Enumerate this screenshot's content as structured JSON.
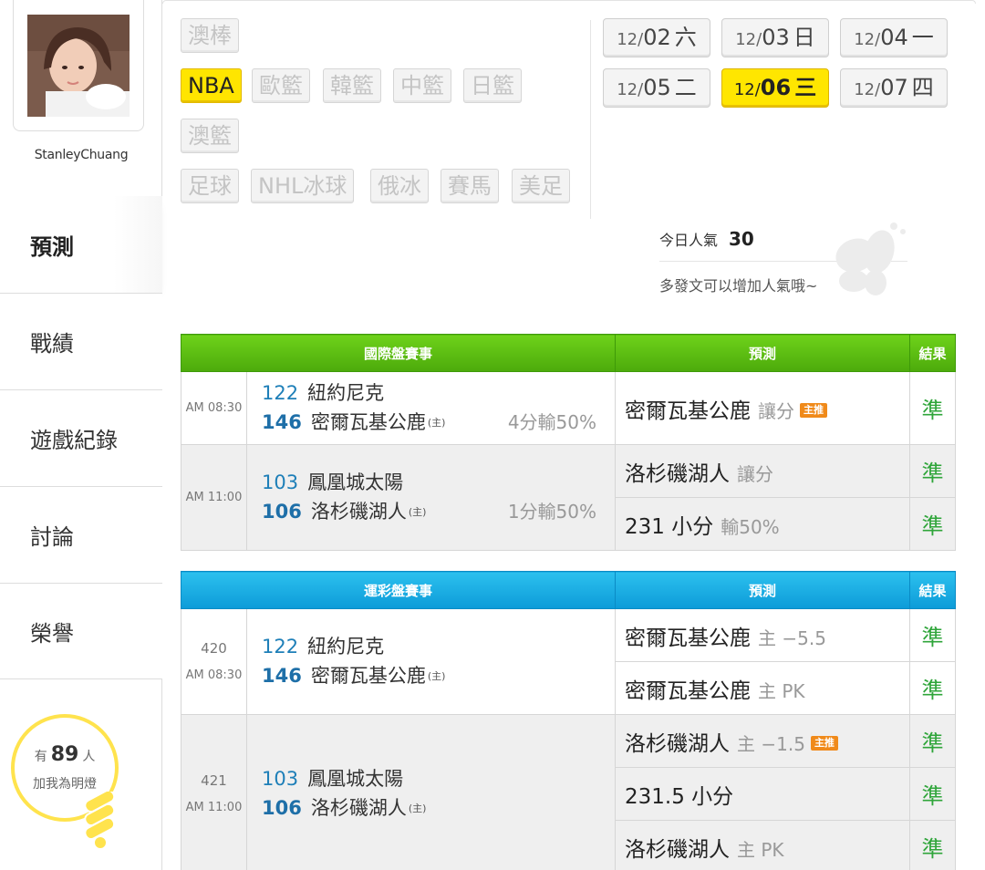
{
  "user": {
    "name": "StanleyChuang"
  },
  "nav": [
    {
      "label": "預測"
    },
    {
      "label": "戰績"
    },
    {
      "label": "遊戲紀錄"
    },
    {
      "label": "討論"
    },
    {
      "label": "榮譽"
    }
  ],
  "fans": {
    "prefix": "有",
    "count": "89",
    "suffix": "人",
    "line2": "加我為明燈"
  },
  "sports": [
    "澳棒",
    "NBA",
    "歐籃",
    "韓籃",
    "中籃",
    "日籃",
    "澳籃",
    "足球",
    "NHL冰球",
    "俄冰",
    "賽馬",
    "美足"
  ],
  "active_sport": "NBA",
  "dates": [
    {
      "md": "12/",
      "day": "02",
      "wk": "六"
    },
    {
      "md": "12/",
      "day": "03",
      "wk": "日"
    },
    {
      "md": "12/",
      "day": "04",
      "wk": "一"
    },
    {
      "md": "12/",
      "day": "05",
      "wk": "二"
    },
    {
      "md": "12/",
      "day": "06",
      "wk": "三"
    },
    {
      "md": "12/",
      "day": "07",
      "wk": "四"
    }
  ],
  "active_date": "12/06",
  "popularity": {
    "label": "今日人氣",
    "value": "30",
    "tip": "多發文可以增加人氣哦~"
  },
  "intl": {
    "headers": {
      "match": "國際盤賽事",
      "pred": "預測",
      "result": "結果"
    },
    "games": [
      {
        "time": "AM 08:30",
        "away_no": "122",
        "away": "紐約尼克",
        "home_no": "146",
        "home": "密爾瓦基公鹿",
        "host": "(主)",
        "spread": "4分輸50%",
        "preds": [
          {
            "main": "密爾瓦基公鹿",
            "sub": "讓分",
            "badge": "主推",
            "result": "準"
          }
        ]
      },
      {
        "time": "AM 11:00",
        "away_no": "103",
        "away": "鳳凰城太陽",
        "home_no": "106",
        "home": "洛杉磯湖人",
        "host": "(主)",
        "spread": "1分輸50%",
        "preds": [
          {
            "main": "洛杉磯湖人",
            "sub": "讓分",
            "result": "準"
          },
          {
            "main": "231 小分",
            "sub": "輸50%",
            "result": "準"
          }
        ]
      }
    ]
  },
  "sportslottery": {
    "headers": {
      "match": "運彩盤賽事",
      "pred": "預測",
      "result": "結果"
    },
    "games": [
      {
        "no": "420",
        "time": "AM 08:30",
        "away_no": "122",
        "away": "紐約尼克",
        "home_no": "146",
        "home": "密爾瓦基公鹿",
        "host": "(主)",
        "preds": [
          {
            "main": "密爾瓦基公鹿",
            "sub": "主 −5.5",
            "result": "準"
          },
          {
            "main": "密爾瓦基公鹿",
            "sub": "主 PK",
            "result": "準"
          }
        ]
      },
      {
        "no": "421",
        "time": "AM 11:00",
        "away_no": "103",
        "away": "鳳凰城太陽",
        "home_no": "106",
        "home": "洛杉磯湖人",
        "host": "(主)",
        "preds": [
          {
            "main": "洛杉磯湖人",
            "sub": "主 −1.5",
            "badge": "主推",
            "result": "準"
          },
          {
            "main": "231.5 小分",
            "sub": "",
            "result": "準"
          },
          {
            "main": "洛杉磯湖人",
            "sub": "主 PK",
            "result": "準"
          }
        ]
      }
    ]
  }
}
